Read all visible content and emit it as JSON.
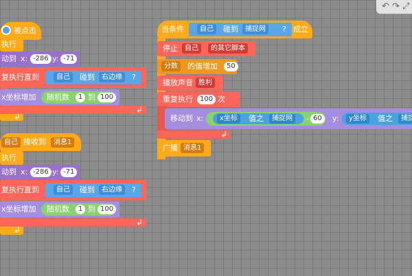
{
  "toolbar": {
    "undo": "↶",
    "redo": "↷",
    "fullscreen": "⤢"
  },
  "script_left_1": {
    "hat_label": "被点击",
    "forever_label": "执行",
    "moveto_label": "动到",
    "x_label": "x:",
    "x_value": "-286",
    "y_label": "y:",
    "y_value": "-71",
    "repeat_until_label": "复执行直到",
    "self_label": "自己",
    "touch_label": "碰到",
    "edge_label": "右边缘",
    "q_label": "?",
    "change_x_label": "x坐标增加",
    "random_label": "随机数",
    "random_from": "1",
    "to_label": "到",
    "random_to": "100"
  },
  "script_left_2": {
    "who_label": "自己",
    "receive_label": "接收到",
    "msg_label": "消息1",
    "forever_label": "执行",
    "moveto_label": "动到",
    "x_label": "x:",
    "x_value": "-286",
    "y_label": "y:",
    "y_value": "-71",
    "repeat_until_label": "复执行直到",
    "self_label": "自己",
    "touch_label": "碰到",
    "edge_label": "右边缘",
    "q_label": "?",
    "change_x_label": "x坐标增加",
    "random_label": "随机数",
    "random_from": "1",
    "to_label": "到",
    "random_to": "100"
  },
  "script_right": {
    "when_label": "当条件",
    "self_label": "自己",
    "touch_label": "碰到",
    "target_label": "捕捉网",
    "q_label": "?",
    "holds_label": "成立",
    "stop_label": "停止",
    "stop_who": "自己",
    "stop_what": "的其它脚本",
    "score_var": "分数",
    "inc_label": "的值增加",
    "inc_value": "50",
    "play_label": "播放声音",
    "sound_name": "胜利",
    "repeat_label": "重复执行",
    "repeat_count": "100",
    "times_label": "次",
    "moveto_label": "移动到",
    "x_label": "x:",
    "xcoord_label": "x坐标",
    "value_label": "值之",
    "of_obj_1": "捕捉网",
    "minus_value": "60",
    "y_label": "y:",
    "ycoord_label": "y坐标",
    "of_obj_2": "捕捉",
    "broadcast_label": "广播",
    "broadcast_msg": "消息1"
  }
}
